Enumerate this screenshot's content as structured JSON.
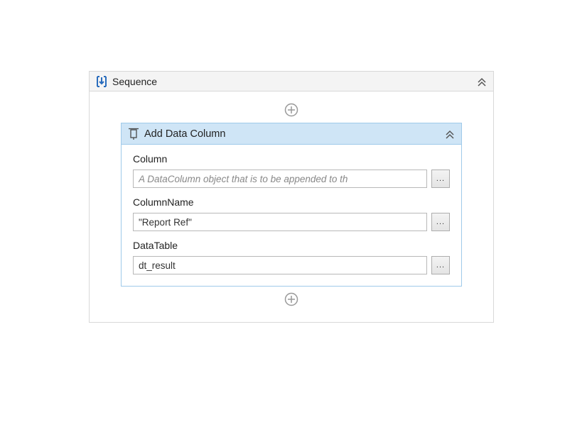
{
  "sequence": {
    "title": "Sequence"
  },
  "activity": {
    "title": "Add Data Column",
    "fields": {
      "column": {
        "label": "Column",
        "placeholder": "A DataColumn object that is to be appended to th",
        "value": ""
      },
      "columnName": {
        "label": "ColumnName",
        "value": "\"Report Ref\""
      },
      "dataTable": {
        "label": "DataTable",
        "value": "dt_result"
      }
    }
  },
  "ellipsis": "..."
}
